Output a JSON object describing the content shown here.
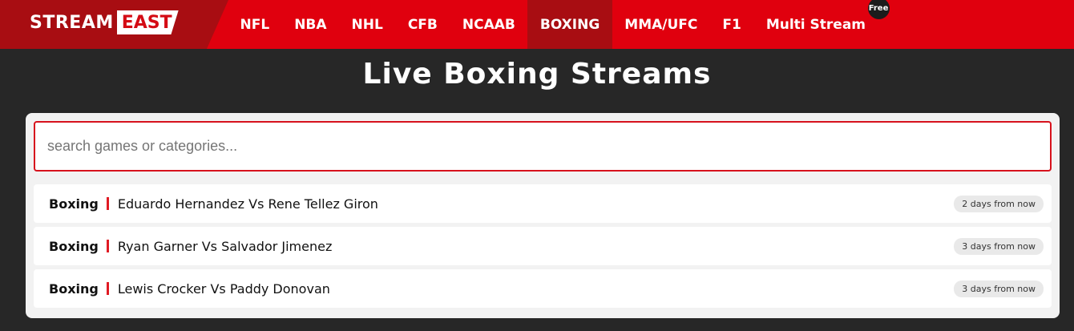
{
  "header": {
    "logo_stream": "STREAM",
    "logo_east": "EAST",
    "nav": [
      {
        "label": "NFL",
        "active": false
      },
      {
        "label": "NBA",
        "active": false
      },
      {
        "label": "NHL",
        "active": false
      },
      {
        "label": "CFB",
        "active": false
      },
      {
        "label": "NCAAB",
        "active": false
      },
      {
        "label": "BOXING",
        "active": true
      },
      {
        "label": "MMA/UFC",
        "active": false
      },
      {
        "label": "F1",
        "active": false
      },
      {
        "label": "Multi Stream",
        "active": false,
        "badge": "Free"
      }
    ],
    "colors": {
      "bar": "#e0000e",
      "logo_block": "#a80d12",
      "active_item": "#a80d12"
    }
  },
  "main": {
    "title": "Live Boxing Streams",
    "search": {
      "placeholder": "search games or categories...",
      "value": ""
    },
    "events": [
      {
        "category": "Boxing",
        "name": "Eduardo Hernandez Vs Rene Tellez Giron",
        "time": "2 days from now"
      },
      {
        "category": "Boxing",
        "name": "Ryan Garner Vs Salvador Jimenez",
        "time": "3 days from now"
      },
      {
        "category": "Boxing",
        "name": "Lewis Crocker Vs Paddy Donovan",
        "time": "3 days from now"
      }
    ]
  }
}
